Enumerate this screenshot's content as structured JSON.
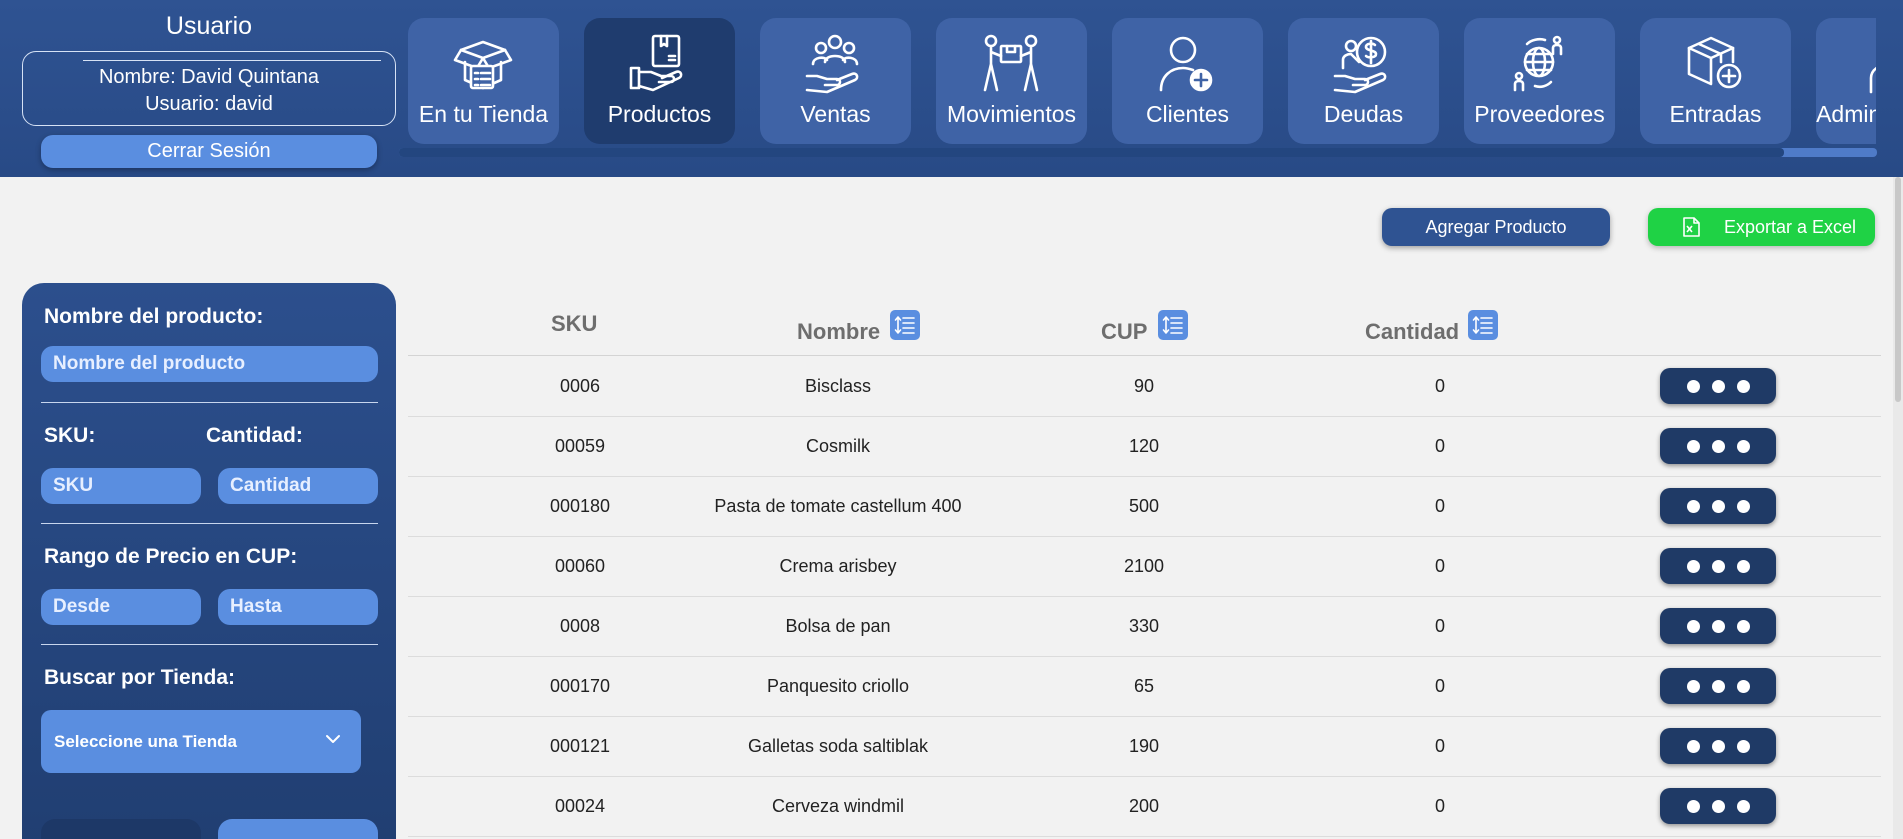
{
  "header": {
    "user_title": "Usuario",
    "user_name_line": "Nombre: David Quintana",
    "user_login_line": "Usuario: david",
    "logout_label": "Cerrar Sesión"
  },
  "nav": {
    "items": [
      {
        "label": "En tu Tienda",
        "icon": "store-box-icon"
      },
      {
        "label": "Productos",
        "icon": "product-hand-icon"
      },
      {
        "label": "Ventas",
        "icon": "sales-people-icon"
      },
      {
        "label": "Movimientos",
        "icon": "movers-box-icon"
      },
      {
        "label": "Clientes",
        "icon": "add-client-icon"
      },
      {
        "label": "Deudas",
        "icon": "debt-money-icon"
      },
      {
        "label": "Proveedores",
        "icon": "suppliers-globe-icon"
      },
      {
        "label": "Entradas",
        "icon": "add-box-icon"
      },
      {
        "label": "Administración",
        "icon": "admin-user-icon"
      }
    ],
    "active": "Productos"
  },
  "actions": {
    "add_product_label": "Agregar Producto",
    "export_excel_label": "Exportar a Excel",
    "export_icon": "excel-icon"
  },
  "filters": {
    "name_label": "Nombre del producto:",
    "name_placeholder": "Nombre del producto",
    "sku_label": "SKU:",
    "sku_placeholder": "SKU",
    "qty_label": "Cantidad:",
    "qty_placeholder": "Cantidad",
    "price_label": "Rango de Precio en CUP:",
    "price_from_placeholder": "Desde",
    "price_to_placeholder": "Hasta",
    "store_label": "Buscar por Tienda:",
    "store_select_value": "Seleccione una Tienda"
  },
  "table": {
    "columns": [
      "SKU",
      "Nombre",
      "CUP",
      "Cantidad"
    ],
    "rows": [
      {
        "sku": "0006",
        "name": "Bisclass",
        "cup": "90",
        "qty": "0"
      },
      {
        "sku": "00059",
        "name": "Cosmilk",
        "cup": "120",
        "qty": "0"
      },
      {
        "sku": "000180",
        "name": "Pasta de tomate castellum 400",
        "cup": "500",
        "qty": "0"
      },
      {
        "sku": "00060",
        "name": "Crema arisbey",
        "cup": "2100",
        "qty": "0"
      },
      {
        "sku": "0008",
        "name": "Bolsa de pan",
        "cup": "330",
        "qty": "0"
      },
      {
        "sku": "000170",
        "name": "Panquesito criollo",
        "cup": "65",
        "qty": "0"
      },
      {
        "sku": "000121",
        "name": "Galletas soda saltiblak",
        "cup": "190",
        "qty": "0"
      },
      {
        "sku": "00024",
        "name": "Cerveza windmil",
        "cup": "200",
        "qty": "0"
      }
    ]
  },
  "colors": {
    "header_bg": "#2f5392",
    "nav_tile": "#3f63a6",
    "nav_tile_active": "#1f3c6e",
    "accent_light": "#5a8ee0",
    "excel_green": "#1fd245",
    "row_action": "#1f3a66"
  }
}
